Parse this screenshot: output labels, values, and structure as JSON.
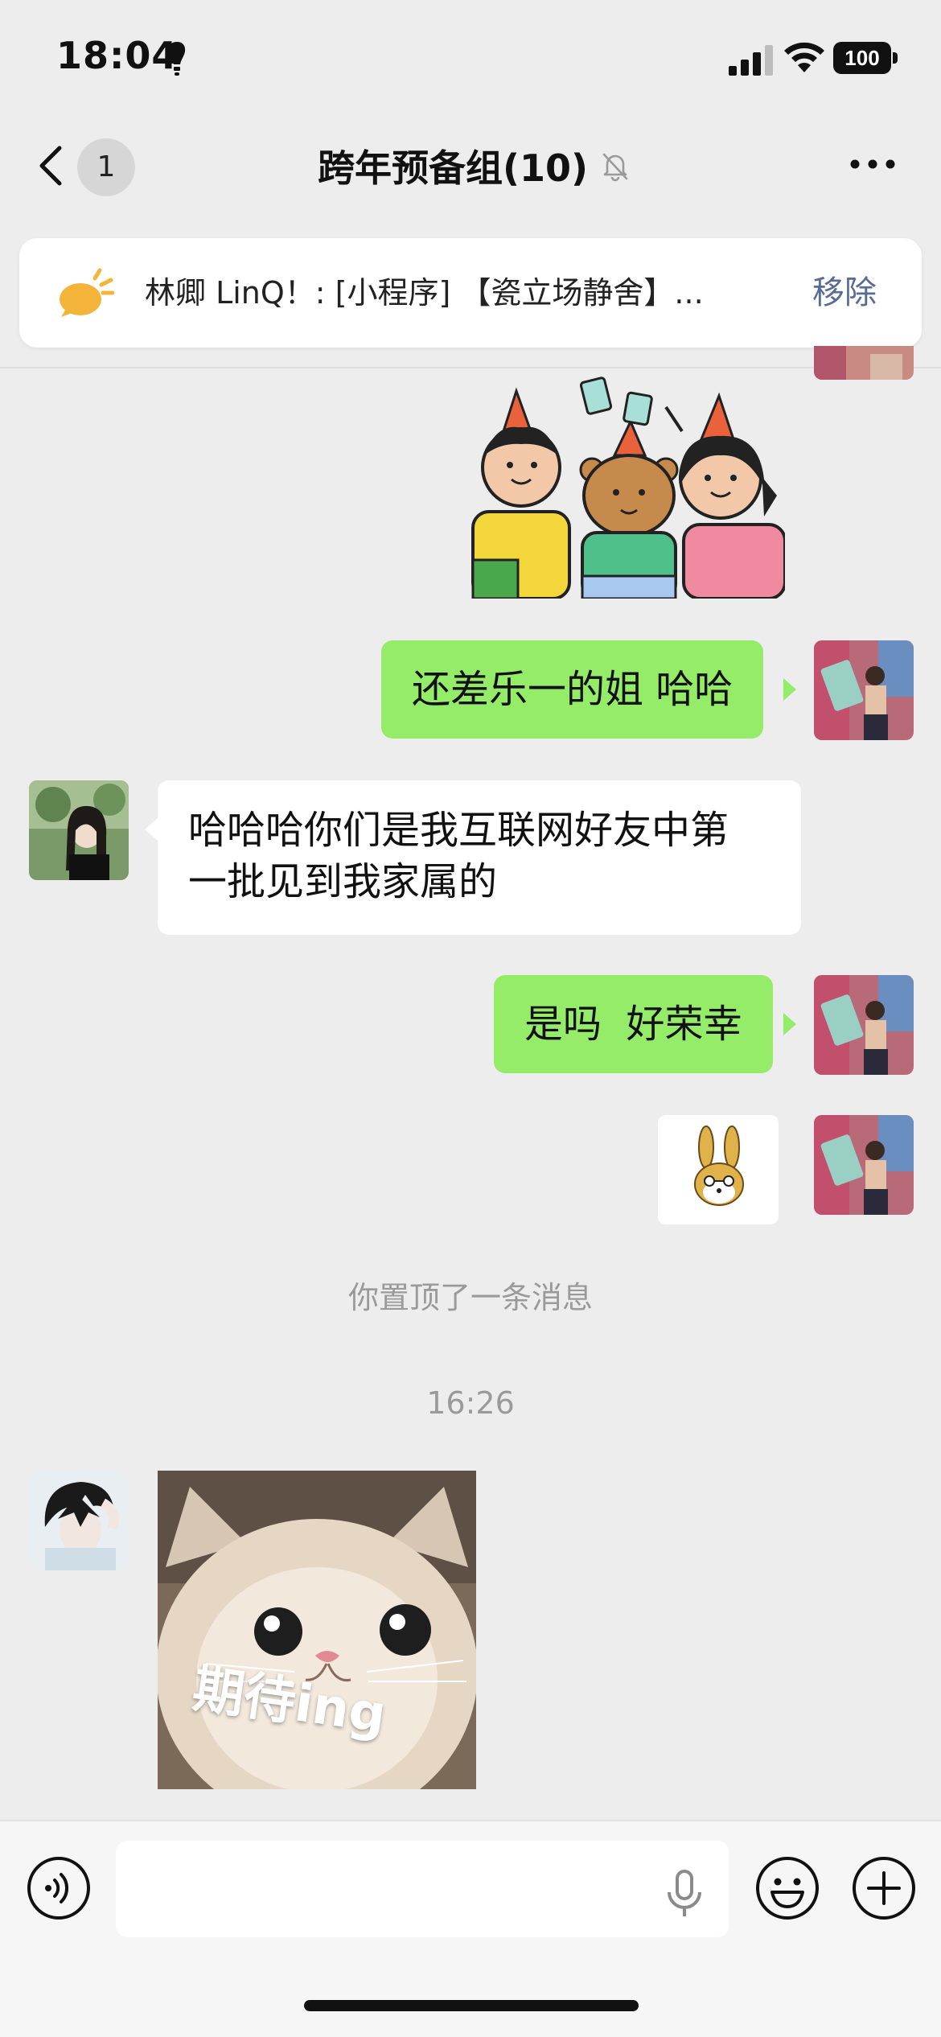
{
  "status_bar": {
    "time": "18:04",
    "battery": "100",
    "icons": [
      "bulb-icon",
      "signal-icon",
      "wifi-icon",
      "battery-icon"
    ]
  },
  "nav": {
    "back_icon": "chevron-left-icon",
    "unread_count": "1",
    "title": "跨年预备组(10)",
    "mute_icon": "bell-off-icon",
    "more_icon": "more-dots-icon"
  },
  "pinned": {
    "icon": "announcement-icon",
    "text": "林卿 LinQ！: [小程序] 【瓷立场静舍】...",
    "remove_label": "移除"
  },
  "messages": [
    {
      "type": "sticker",
      "side": "right",
      "sticker": "party-friends-sticker"
    },
    {
      "type": "text",
      "side": "right",
      "text": "还差乐一的姐 哈哈"
    },
    {
      "type": "text",
      "side": "left",
      "lines": [
        "哈哈哈你们是我互联网好友中第",
        "一批见到我家属的"
      ]
    },
    {
      "type": "text",
      "side": "right",
      "text": "是吗  好荣幸"
    },
    {
      "type": "sticker",
      "side": "right",
      "sticker": "bunny-sticker"
    },
    {
      "type": "system",
      "text": "你置顶了一条消息"
    },
    {
      "type": "time",
      "text": "16:26"
    },
    {
      "type": "sticker",
      "side": "left",
      "sticker": "cat-sticker",
      "caption": "期待ing"
    }
  ],
  "input_bar": {
    "voice_icon": "voice-icon",
    "input_value": "",
    "mic_icon": "microphone-icon",
    "emoji_icon": "emoji-icon",
    "plus_icon": "plus-icon"
  },
  "colors": {
    "background": "#ededed",
    "bubble_green": "#95ec69",
    "bubble_white": "#ffffff",
    "link_blue": "#576b95",
    "system_gray": "#9a9a9a"
  }
}
